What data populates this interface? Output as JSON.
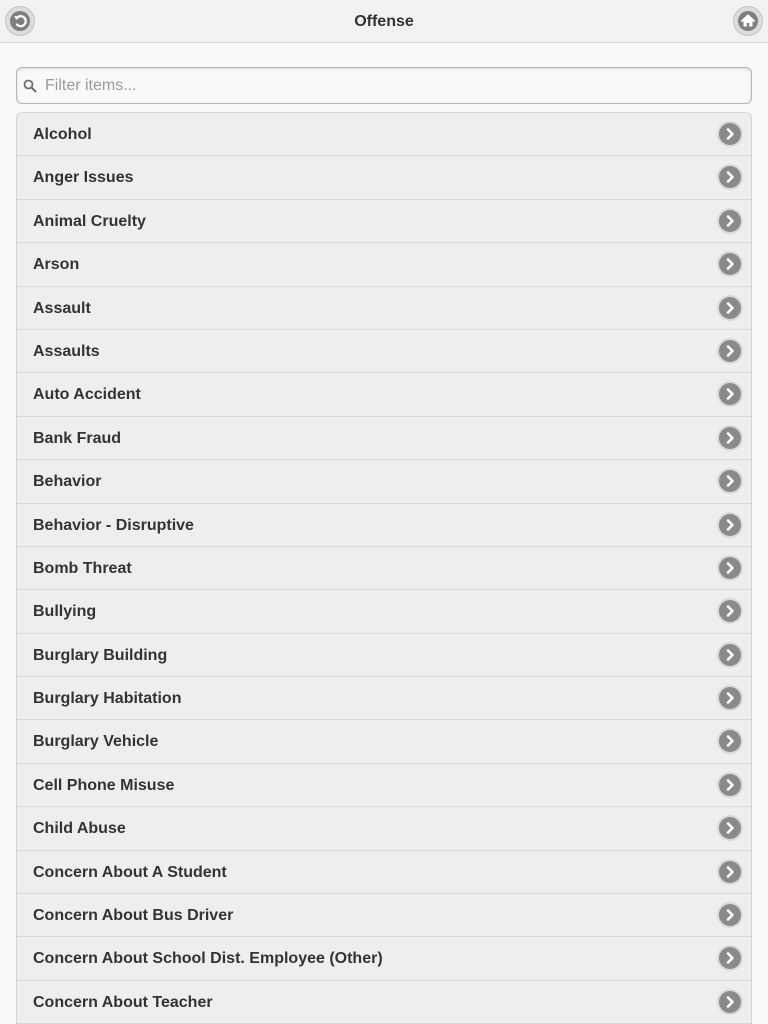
{
  "header": {
    "title": "Offense",
    "back_icon": "back-icon",
    "home_icon": "home-icon"
  },
  "search": {
    "placeholder": "Filter items...",
    "value": ""
  },
  "list": {
    "items": [
      {
        "label": "Alcohol"
      },
      {
        "label": "Anger Issues"
      },
      {
        "label": "Animal Cruelty"
      },
      {
        "label": "Arson"
      },
      {
        "label": "Assault"
      },
      {
        "label": "Assaults"
      },
      {
        "label": "Auto Accident"
      },
      {
        "label": "Bank Fraud"
      },
      {
        "label": "Behavior"
      },
      {
        "label": "Behavior - Disruptive"
      },
      {
        "label": "Bomb Threat"
      },
      {
        "label": "Bullying"
      },
      {
        "label": "Burglary Building"
      },
      {
        "label": "Burglary Habitation"
      },
      {
        "label": "Burglary Vehicle"
      },
      {
        "label": "Cell Phone Misuse"
      },
      {
        "label": "Child Abuse"
      },
      {
        "label": "Concern About A Student"
      },
      {
        "label": "Concern About Bus Driver"
      },
      {
        "label": "Concern About School Dist. Employee (Other)"
      },
      {
        "label": "Concern About Teacher"
      }
    ],
    "chevron_icon": "chevron-right-icon"
  },
  "colors": {
    "header_bg": "#f2f2f2",
    "list_bg": "#eeeeee",
    "text": "#333333",
    "icon_gray": "#8a8a8a"
  }
}
